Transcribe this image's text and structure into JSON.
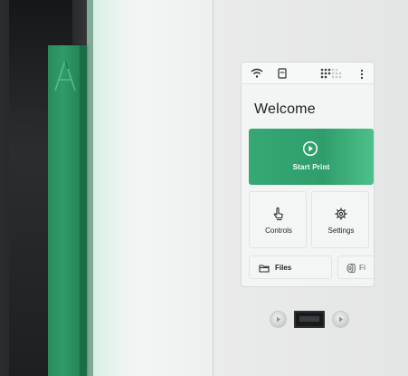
{
  "screen": {
    "title": "Welcome",
    "status_bar": {
      "icons": [
        "wifi-icon",
        "sd-card-icon",
        "grid-icon",
        "more-vertical-icon"
      ]
    },
    "start_print": {
      "label": "Start Print",
      "icon": "play-circle-icon"
    },
    "tiles": [
      {
        "label": "Controls",
        "icon": "hand-pointer-icon"
      },
      {
        "label": "Settings",
        "icon": "gear-icon"
      }
    ],
    "buttons": [
      {
        "label": "Files",
        "icon": "folder-icon"
      },
      {
        "label": "Fi",
        "icon": "filament-spool-icon"
      }
    ]
  },
  "colors": {
    "accent_green": "#2f9e6c",
    "door_green": "#2a8a5d",
    "screen_bg": "#f3f4f4",
    "text_dark": "#1e2022"
  }
}
